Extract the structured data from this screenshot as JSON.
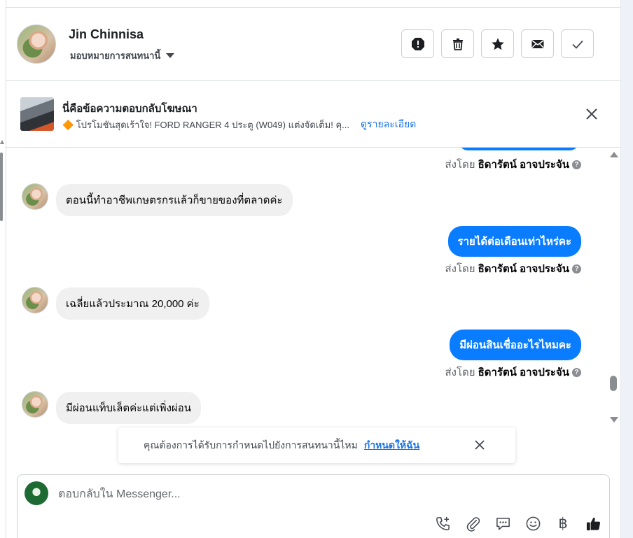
{
  "header": {
    "contact_name": "Jin Chinnisa",
    "assign_label": "มอบหมายการสนทนานี้",
    "actions": [
      "spam-icon",
      "trash-icon",
      "star-icon",
      "envelope-icon",
      "check-icon"
    ]
  },
  "ad": {
    "title": "นี่คือข้อความตอบกลับโฆษณา",
    "subtitle": "🔶 โปรโมชันสุดเร้าใจ! FORD RANGER 4 ประตู (W049) แต่งจัดเต็ม! คุ...",
    "details_link": "ดูรายละเอียด"
  },
  "messages": [
    {
      "side": "out",
      "text": "",
      "partial": true
    },
    {
      "side": "meta",
      "sent_label": "ส่งโดย",
      "agent": "ธิดารัตน์ อาจประจัน"
    },
    {
      "side": "in",
      "text": "ตอนนี้ทำอาชีพเกษตรกรแล้วก็ขายของที่ตลาดค่ะ"
    },
    {
      "side": "out",
      "text": "รายได้ต่อเดือนเท่าไหร่คะ"
    },
    {
      "side": "meta",
      "sent_label": "ส่งโดย",
      "agent": "ธิดารัตน์ อาจประจัน"
    },
    {
      "side": "in",
      "text": "เฉลี่ยแล้วประมาณ 20,000 ค่ะ"
    },
    {
      "side": "out",
      "text": "มีผ่อนสินเชื่ออะไรไหมคะ"
    },
    {
      "side": "meta",
      "sent_label": "ส่งโดย",
      "agent": "ธิดารัตน์ อาจประจัน"
    },
    {
      "side": "in",
      "text": "มีผ่อนแท็บเล็ตค่ะแต่เพิ่งผ่อน"
    }
  ],
  "toast": {
    "text": "คุณต้องการได้รับการกำหนดไปยังการสนทนานี้ไหม",
    "link": "กำหนดให้ฉัน"
  },
  "composer": {
    "placeholder": "ตอบกลับใน Messenger...",
    "tools": [
      "phone-add-icon",
      "paperclip-icon",
      "chat-bubble-icon",
      "emoji-icon",
      "baht-icon",
      "thumbs-up-icon"
    ],
    "baht_symbol": "฿"
  },
  "colors": {
    "outgoing_bubble": "#0a7cff",
    "incoming_bubble": "#f0f0f0",
    "link": "#1b74e4"
  }
}
